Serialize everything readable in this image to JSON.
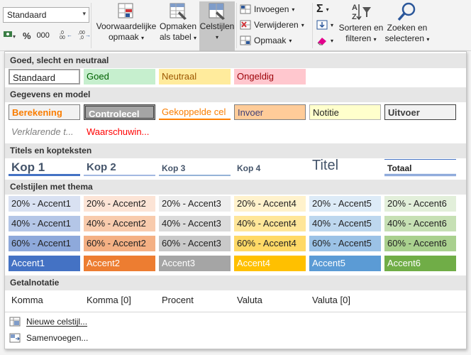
{
  "ribbon": {
    "style_dropdown_value": "Standaard",
    "number_symbols": {
      "percent": "%",
      "thousands": "000",
      "increase_decimal": "←0",
      "decrease_decimal": "→0"
    },
    "conditional_formatting": [
      "Voorwaardelijke",
      "opmaak"
    ],
    "format_as_table": [
      "Opmaken",
      "als tabel"
    ],
    "cell_styles": "Celstijlen",
    "insert": "Invoegen",
    "delete": "Verwijderen",
    "format": "Opmaak",
    "sort_filter": [
      "Sorteren en",
      "filteren"
    ],
    "find_select": [
      "Zoeken en",
      "selecteren"
    ]
  },
  "sections": {
    "good_bad": "Goed, slecht en neutraal",
    "data_model": "Gegevens en model",
    "titles": "Titels en kopteksten",
    "themed": "Celstijlen met thema",
    "number_format": "Getalnotatie"
  },
  "good_bad_styles": [
    "Standaard",
    "Goed",
    "Neutraal",
    "Ongeldig"
  ],
  "data_model_row1": [
    "Berekening",
    "Controlecel",
    "Gekoppelde cel",
    "Invoer",
    "Notitie",
    "Uitvoer"
  ],
  "data_model_row2": [
    "Verklarende t...",
    "Waarschuwin..."
  ],
  "title_styles": [
    "Kop 1",
    "Kop 2",
    "Kop 3",
    "Kop 4",
    "Titel",
    "Totaal"
  ],
  "themed_rows": [
    [
      "20% - Accent1",
      "20% - Accent2",
      "20% - Accent3",
      "20% - Accent4",
      "20% - Accent5",
      "20% - Accent6"
    ],
    [
      "40% - Accent1",
      "40% - Accent2",
      "40% - Accent3",
      "40% - Accent4",
      "40% - Accent5",
      "40% - Accent6"
    ],
    [
      "60% - Accent1",
      "60% - Accent2",
      "60% - Accent3",
      "60% - Accent4",
      "60% - Accent5",
      "60% - Accent6"
    ],
    [
      "Accent1",
      "Accent2",
      "Accent3",
      "Accent4",
      "Accent5",
      "Accent6"
    ]
  ],
  "number_styles": [
    "Komma",
    "Komma [0]",
    "Procent",
    "Valuta",
    "Valuta [0]"
  ],
  "footer": {
    "new_style": "Nieuwe celstijl...",
    "merge": "Samenvoegen..."
  },
  "colors": {
    "good_bg": "#c6efce",
    "good_fg": "#006100",
    "neutral_bg": "#ffeb9c",
    "neutral_fg": "#9c5700",
    "bad_bg": "#ffc7ce",
    "bad_fg": "#9c0006",
    "accent1": "#4472c4",
    "accent2": "#ed7d31",
    "accent3": "#a5a5a5",
    "accent4": "#ffc000",
    "accent5": "#5b9bd5",
    "accent6": "#70ad47"
  }
}
